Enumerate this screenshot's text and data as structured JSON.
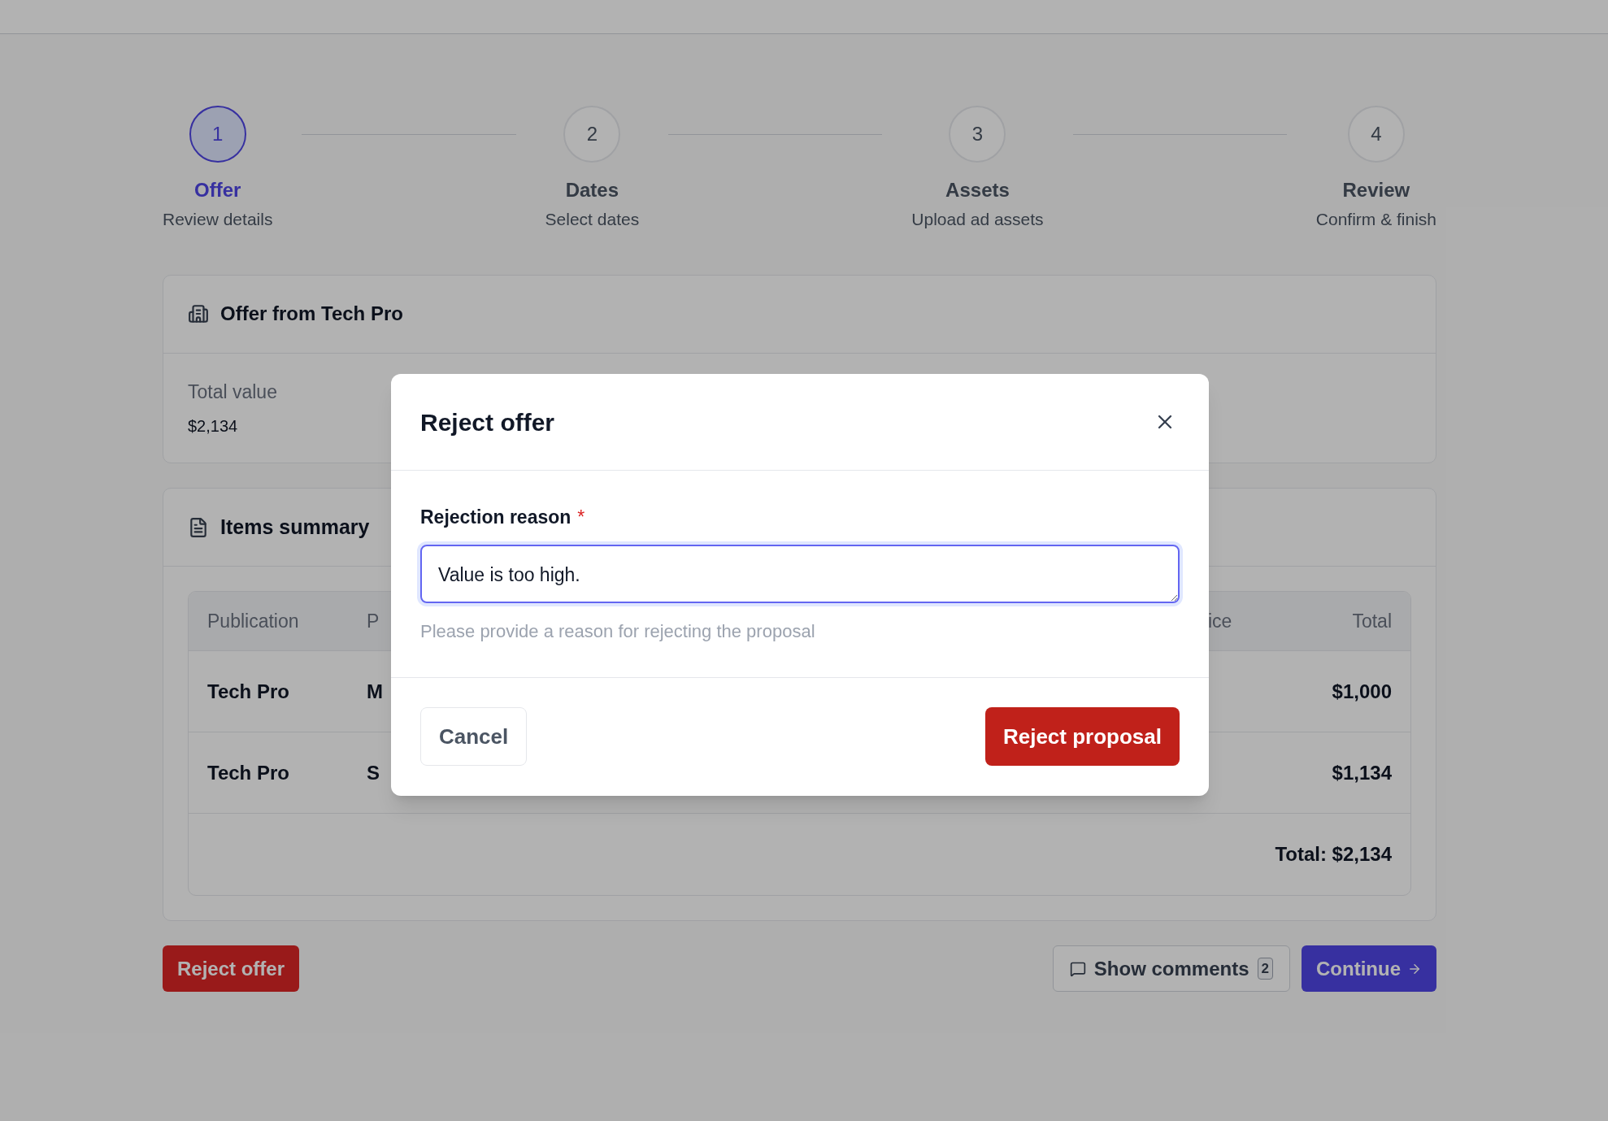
{
  "stepper": [
    {
      "number": "1",
      "title": "Offer",
      "subtitle": "Review details",
      "selected": true
    },
    {
      "number": "2",
      "title": "Dates",
      "subtitle": "Select dates",
      "selected": false
    },
    {
      "number": "3",
      "title": "Assets",
      "subtitle": "Upload ad assets",
      "selected": false
    },
    {
      "number": "4",
      "title": "Review",
      "subtitle": "Confirm & finish",
      "selected": false
    }
  ],
  "offer_card": {
    "title": "Offer from Tech Pro",
    "total_label": "Total value",
    "total_value": "$2,134"
  },
  "items_card": {
    "title": "Items summary",
    "table": {
      "columns": [
        "Publication",
        "P",
        "ice",
        "Total"
      ],
      "rows": [
        [
          "Tech Pro",
          "M",
          "",
          "$1,000"
        ],
        [
          "Tech Pro",
          "S",
          "",
          "$1,134"
        ]
      ],
      "footer": "Total: $2,134"
    }
  },
  "actions": {
    "reject": "Reject offer",
    "comments": "Show comments",
    "comments_count": "2",
    "continue": "Continue"
  },
  "dialog": {
    "title": "Reject offer",
    "field_label": "Rejection reason",
    "required_mark": "*",
    "value": "Value is too high.",
    "help": "Please provide a reason for rejecting the proposal",
    "cancel": "Cancel",
    "confirm": "Reject proposal"
  }
}
